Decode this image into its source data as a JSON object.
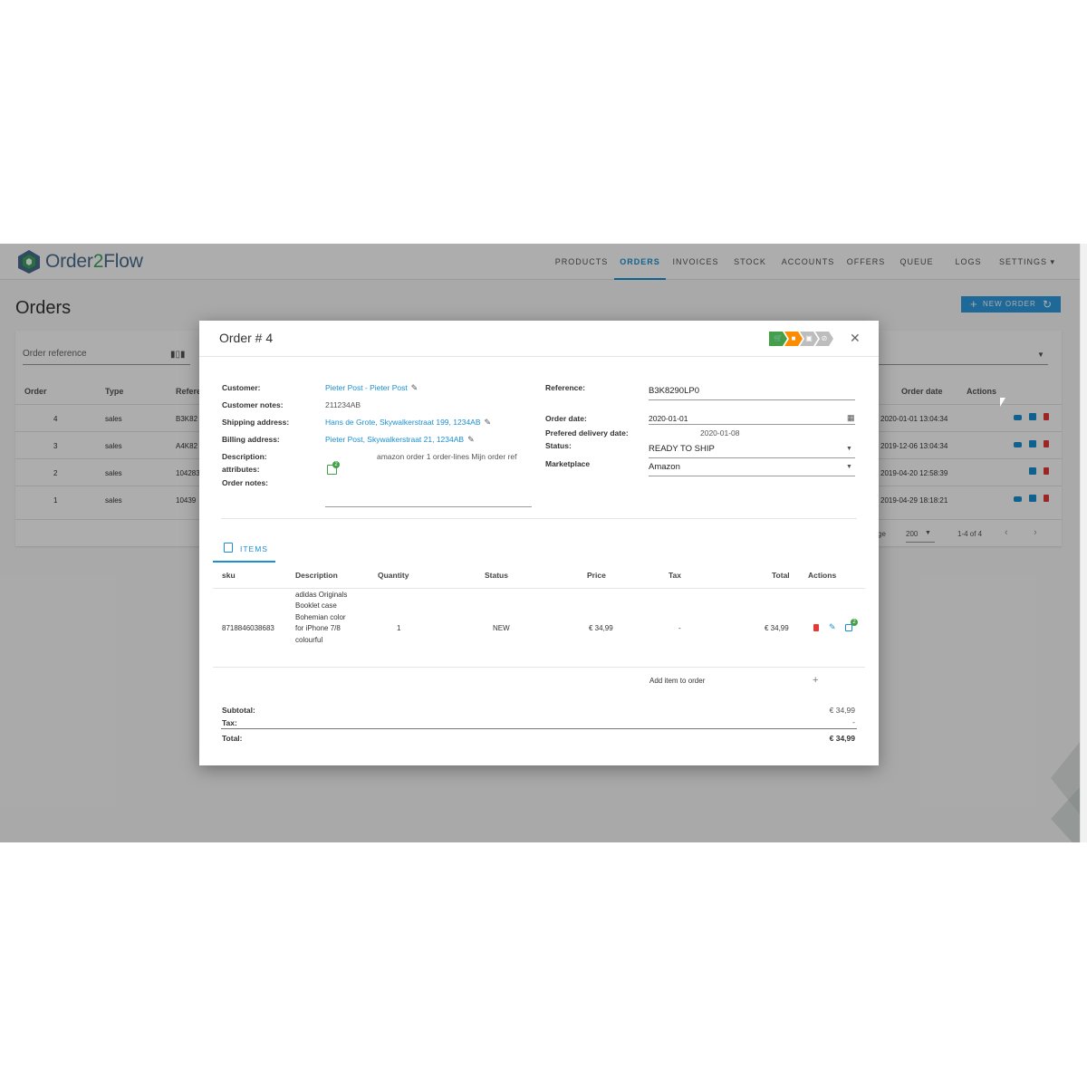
{
  "app": {
    "logo": "Order2Flow",
    "nav": [
      "PRODUCTS",
      "ORDERS",
      "INVOICES",
      "STOCK",
      "ACCOUNTS",
      "OFFERS",
      "QUEUE",
      "LOGS",
      "SETTINGS"
    ],
    "page_title": "Orders",
    "new_order_label": "NEW ORDER",
    "filter_placeholder": "Order reference",
    "table_headers": {
      "order": "Order",
      "type": "Type",
      "reference": "Refere",
      "order_date": "Order date",
      "actions": "Actions"
    },
    "rows": [
      {
        "order": "4",
        "type": "sales",
        "ref": "B3K82",
        "date": "2020-01-01 13:04:34"
      },
      {
        "order": "3",
        "type": "sales",
        "ref": "A4K82",
        "date": "2019-12-06 13:04:34"
      },
      {
        "order": "2",
        "type": "sales",
        "ref": "104283",
        "date": "2019-04-20 12:58:39"
      },
      {
        "order": "1",
        "type": "sales",
        "ref": "10439",
        "date": "2019-04-29 18:18:21"
      }
    ],
    "pager": {
      "label_fragment": "ge",
      "page_size": "200",
      "range": "1-4 of 4"
    }
  },
  "modal": {
    "title": "Order # 4",
    "customer_label": "Customer:",
    "customer": "Pieter Post - Pieter Post",
    "customer_notes_label": "Customer notes:",
    "customer_notes": "211234AB",
    "shipping_label": "Shipping address:",
    "shipping": "Hans de Grote, Skywalkerstraat 199, 1234AB",
    "billing_label": "Billing address:",
    "billing": "Pieter Post, Skywalkerstraat 21, 1234AB",
    "description_label": "Description:",
    "description": "amazon order 1 order-lines Mijn order ref",
    "attributes_label": "attributes:",
    "attributes_count": "2",
    "order_notes_label": "Order notes:",
    "reference_label": "Reference:",
    "reference": "B3K8290LP0",
    "order_date_label": "Order date:",
    "order_date": "2020-01-01",
    "delivery_label": "Prefered delivery date:",
    "delivery_date": "2020-01-08",
    "status_label": "Status:",
    "status": "READY TO SHIP",
    "marketplace_label": "Marketplace",
    "marketplace": "Amazon",
    "tab_label": "ITEMS",
    "items_headers": {
      "sku": "sku",
      "description": "Description",
      "quantity": "Quantity",
      "status": "Status",
      "price": "Price",
      "tax": "Tax",
      "total": "Total",
      "actions": "Actions"
    },
    "item": {
      "sku": "8718846038683",
      "description": "adidas Originals Booklet case Bohemian color for iPhone 7/8 colourful",
      "quantity": "1",
      "status": "NEW",
      "price": "€ 34,99",
      "tax": "-",
      "total": "€ 34,99",
      "attributes_count": "2"
    },
    "add_item_label": "Add item to order",
    "subtotal_label": "Subtotal:",
    "subtotal": "€ 34,99",
    "tax_label": "Tax:",
    "tax": "-",
    "total_label": "Total:",
    "total": "€ 34,99"
  },
  "colors": {
    "accent": "#1a8fd1",
    "green": "#43a047",
    "orange": "#fb8c00",
    "danger": "#e53935"
  }
}
